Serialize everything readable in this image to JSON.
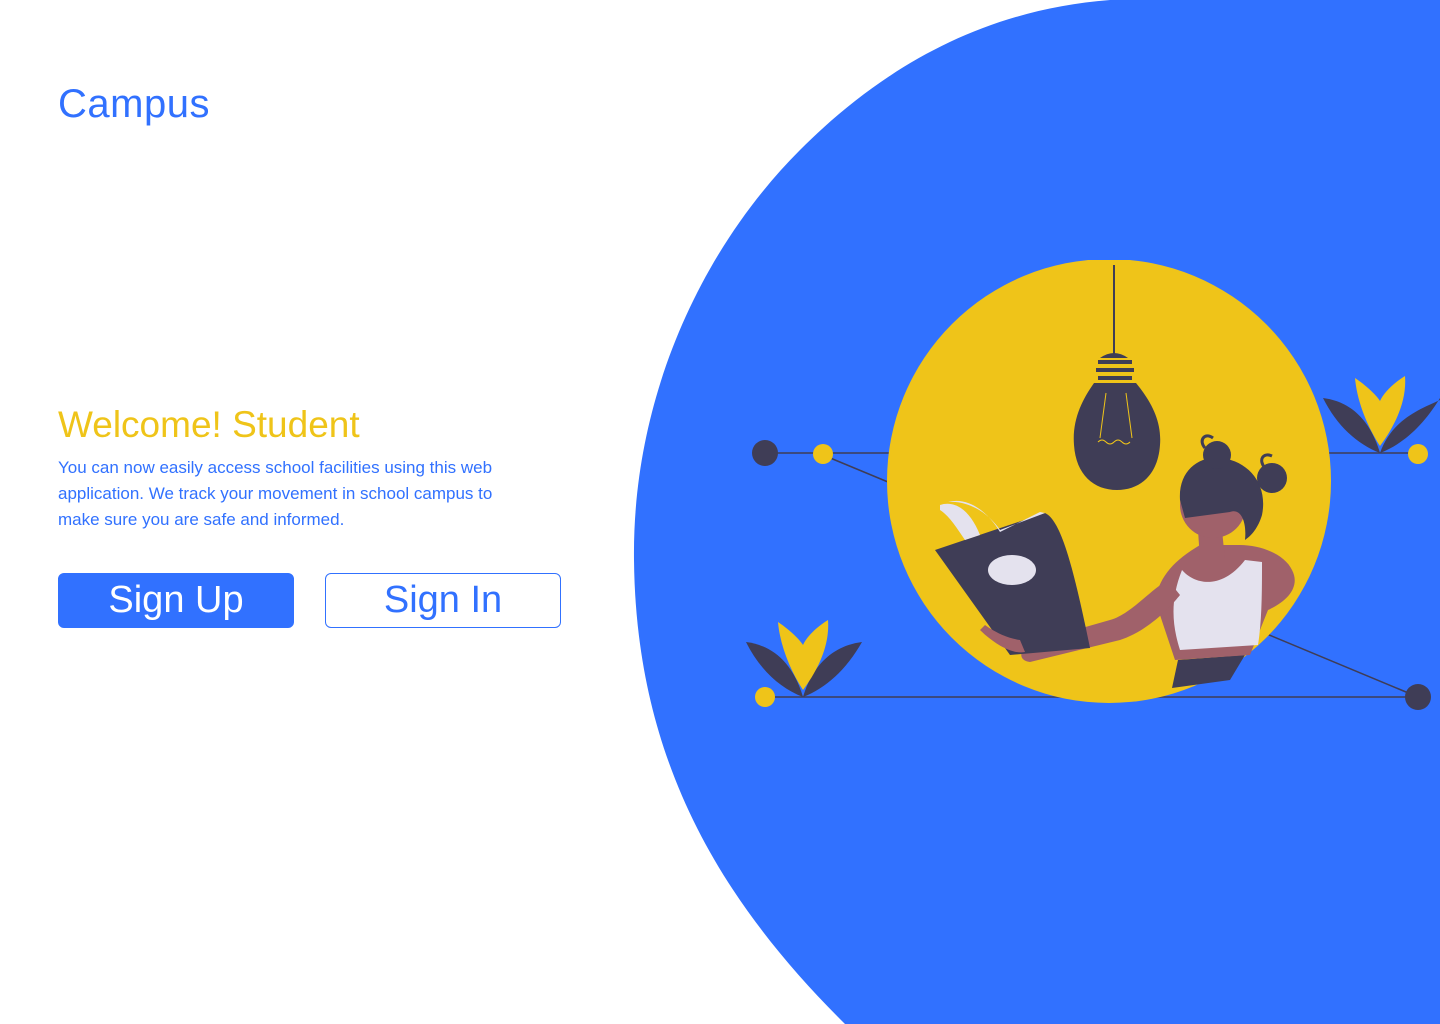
{
  "brand": {
    "name": "Campus"
  },
  "hero": {
    "title": "Welcome! Student",
    "description": "You can now easily access school facilities using this web application. We track your movement in school campus to make sure you are safe and informed."
  },
  "actions": {
    "signup_label": "Sign Up",
    "signin_label": "Sign In"
  },
  "colors": {
    "primary": "#3171ff",
    "accent": "#efc419",
    "dark": "#3f3d56",
    "background": "#ffffff"
  },
  "illustration": {
    "subject": "student-reading-book-under-lightbulb"
  }
}
